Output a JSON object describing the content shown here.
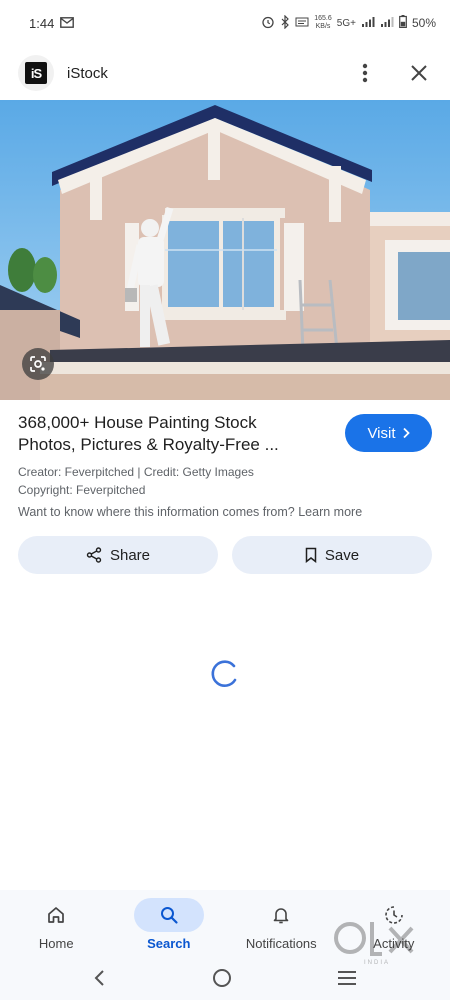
{
  "status_bar": {
    "time": "1:44",
    "speed_value": "165.6",
    "speed_unit": "KB/s",
    "network": "5G+",
    "battery": "50%"
  },
  "source": {
    "logo_text": "iS",
    "name": "iStock",
    "more_icon": "more-vert-icon",
    "close_icon": "close-icon"
  },
  "result": {
    "title": "368,000+ House Painting Stock Photos, Pictures & Royalty-Free ...",
    "visit_label": "Visit",
    "creator": "Creator: Feverpitched | Credit: Getty Images",
    "copyright": "Copyright: Feverpitched",
    "info_question": "Want to know where this information comes from?",
    "learn_more": "Learn more"
  },
  "actions": {
    "share_label": "Share",
    "save_label": "Save"
  },
  "bottom_nav": {
    "items": [
      {
        "label": "Home",
        "icon": "home-icon"
      },
      {
        "label": "Search",
        "icon": "search-icon",
        "active": true
      },
      {
        "label": "Notifications",
        "icon": "bell-icon"
      },
      {
        "label": "Activity",
        "icon": "activity-icon"
      }
    ]
  },
  "watermark": {
    "text": "INDIA"
  },
  "colors": {
    "accent": "#1a73e8",
    "pill_bg": "#e8eef8",
    "active_nav_bg": "#d3e3fd",
    "active_nav_text": "#0b57d0"
  }
}
